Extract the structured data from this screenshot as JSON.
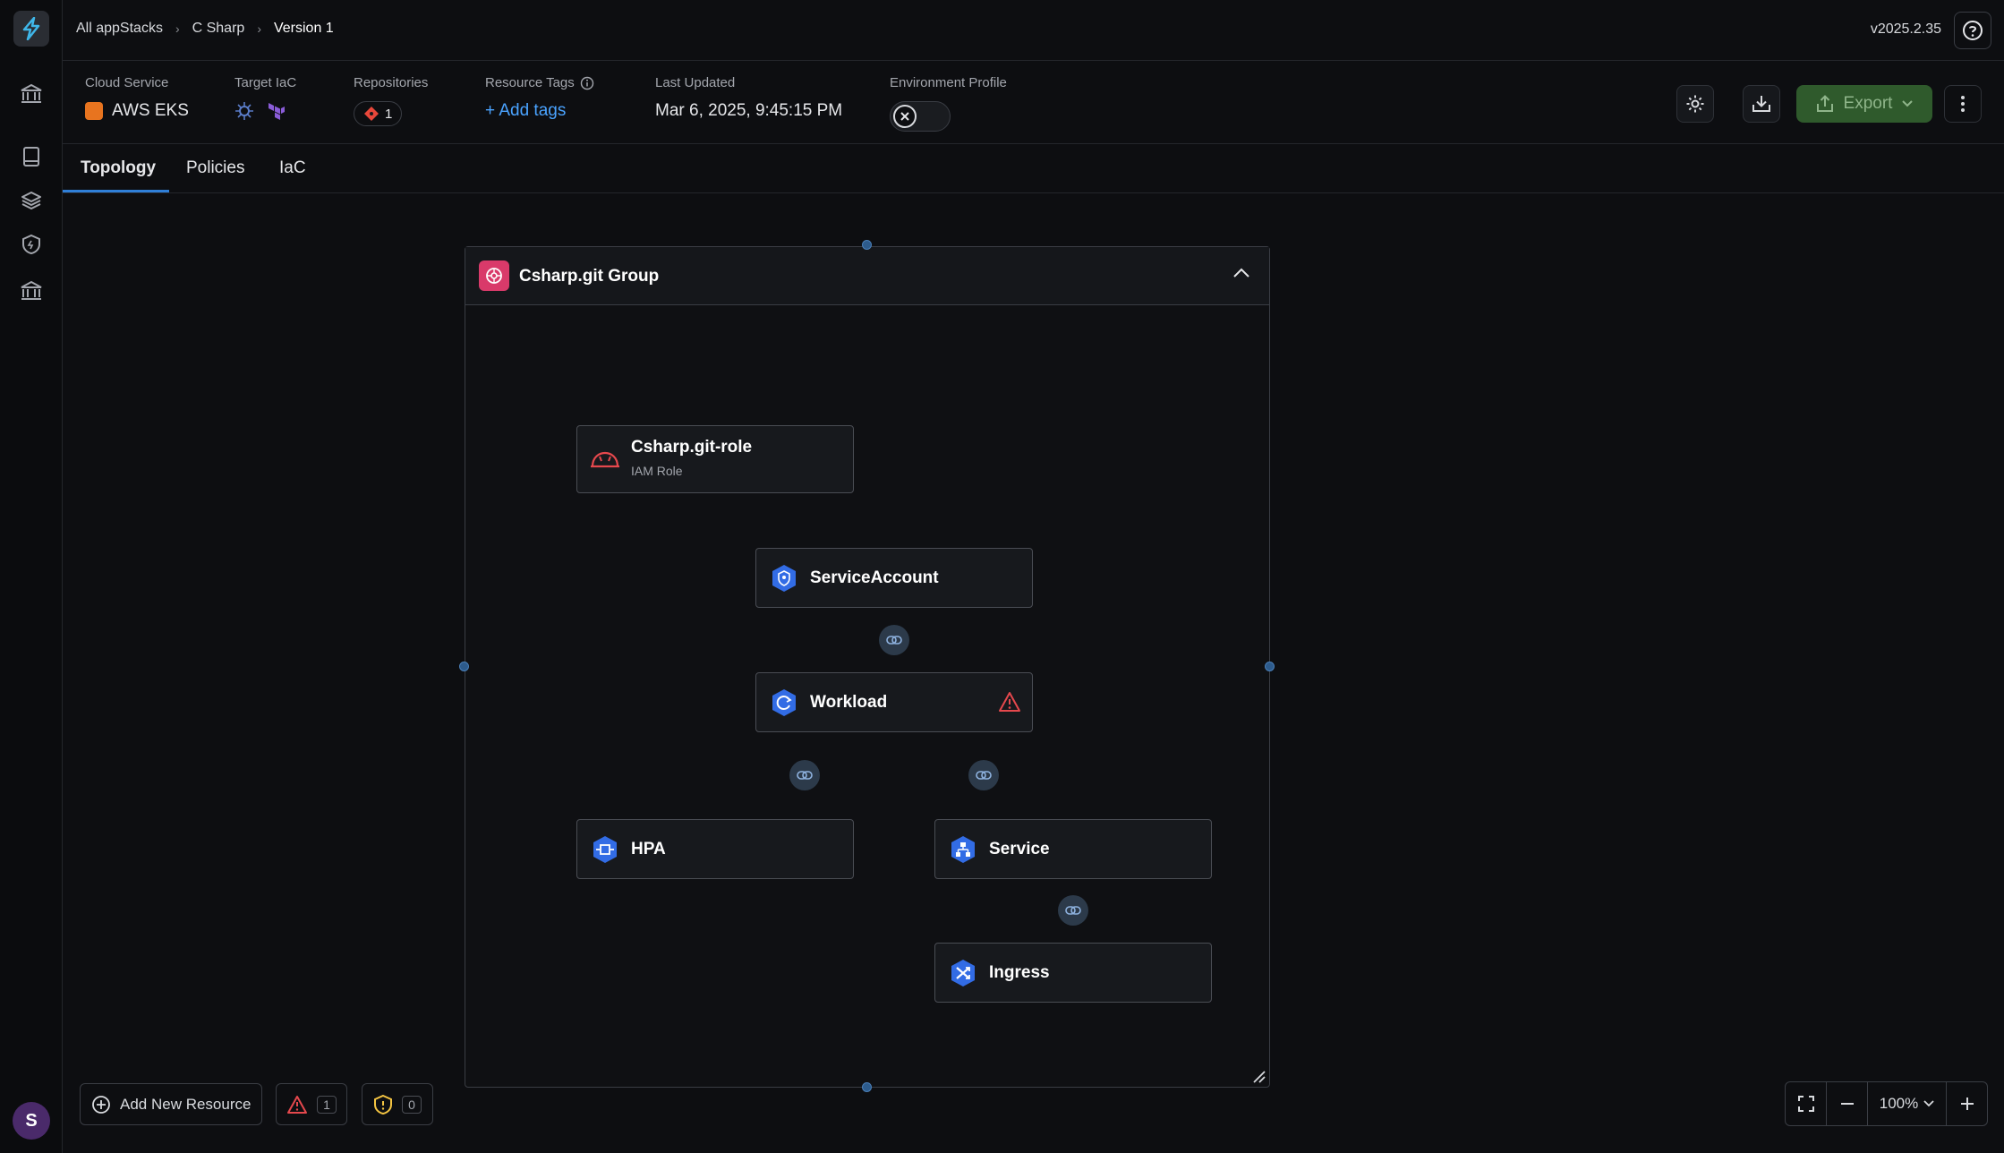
{
  "breadcrumb": [
    "All appStacks",
    "C Sharp",
    "Version 1"
  ],
  "app_version": "v2025.2.35",
  "info": {
    "cloud_service_label": "Cloud Service",
    "cloud_service_value": "AWS EKS",
    "target_iac_label": "Target IaC",
    "repositories_label": "Repositories",
    "repositories_count": "1",
    "resource_tags_label": "Resource Tags",
    "add_tags": "+ Add tags",
    "last_updated_label": "Last Updated",
    "last_updated_value": "Mar 6, 2025, 9:45:15 PM",
    "env_profile_label": "Environment Profile"
  },
  "actions": {
    "export_label": "Export"
  },
  "tabs": [
    "Topology",
    "Policies",
    "IaC"
  ],
  "group": {
    "title": "Csharp.git Group"
  },
  "nodes": {
    "role": {
      "name": "Csharp.git-role",
      "sub": "IAM Role"
    },
    "service_account": {
      "name": "ServiceAccount"
    },
    "workload": {
      "name": "Workload"
    },
    "hpa": {
      "name": "HPA"
    },
    "service": {
      "name": "Service"
    },
    "ingress": {
      "name": "Ingress"
    }
  },
  "bottom": {
    "add_resource": "Add New Resource",
    "warnings_count": "1",
    "policy_count": "0",
    "zoom": "100%"
  },
  "user": {
    "initial": "S"
  },
  "colors": {
    "accent": "#2f7fd8",
    "export_bg": "#2f5a2c",
    "warning": "#e5484d",
    "policy": "#f5c542"
  }
}
